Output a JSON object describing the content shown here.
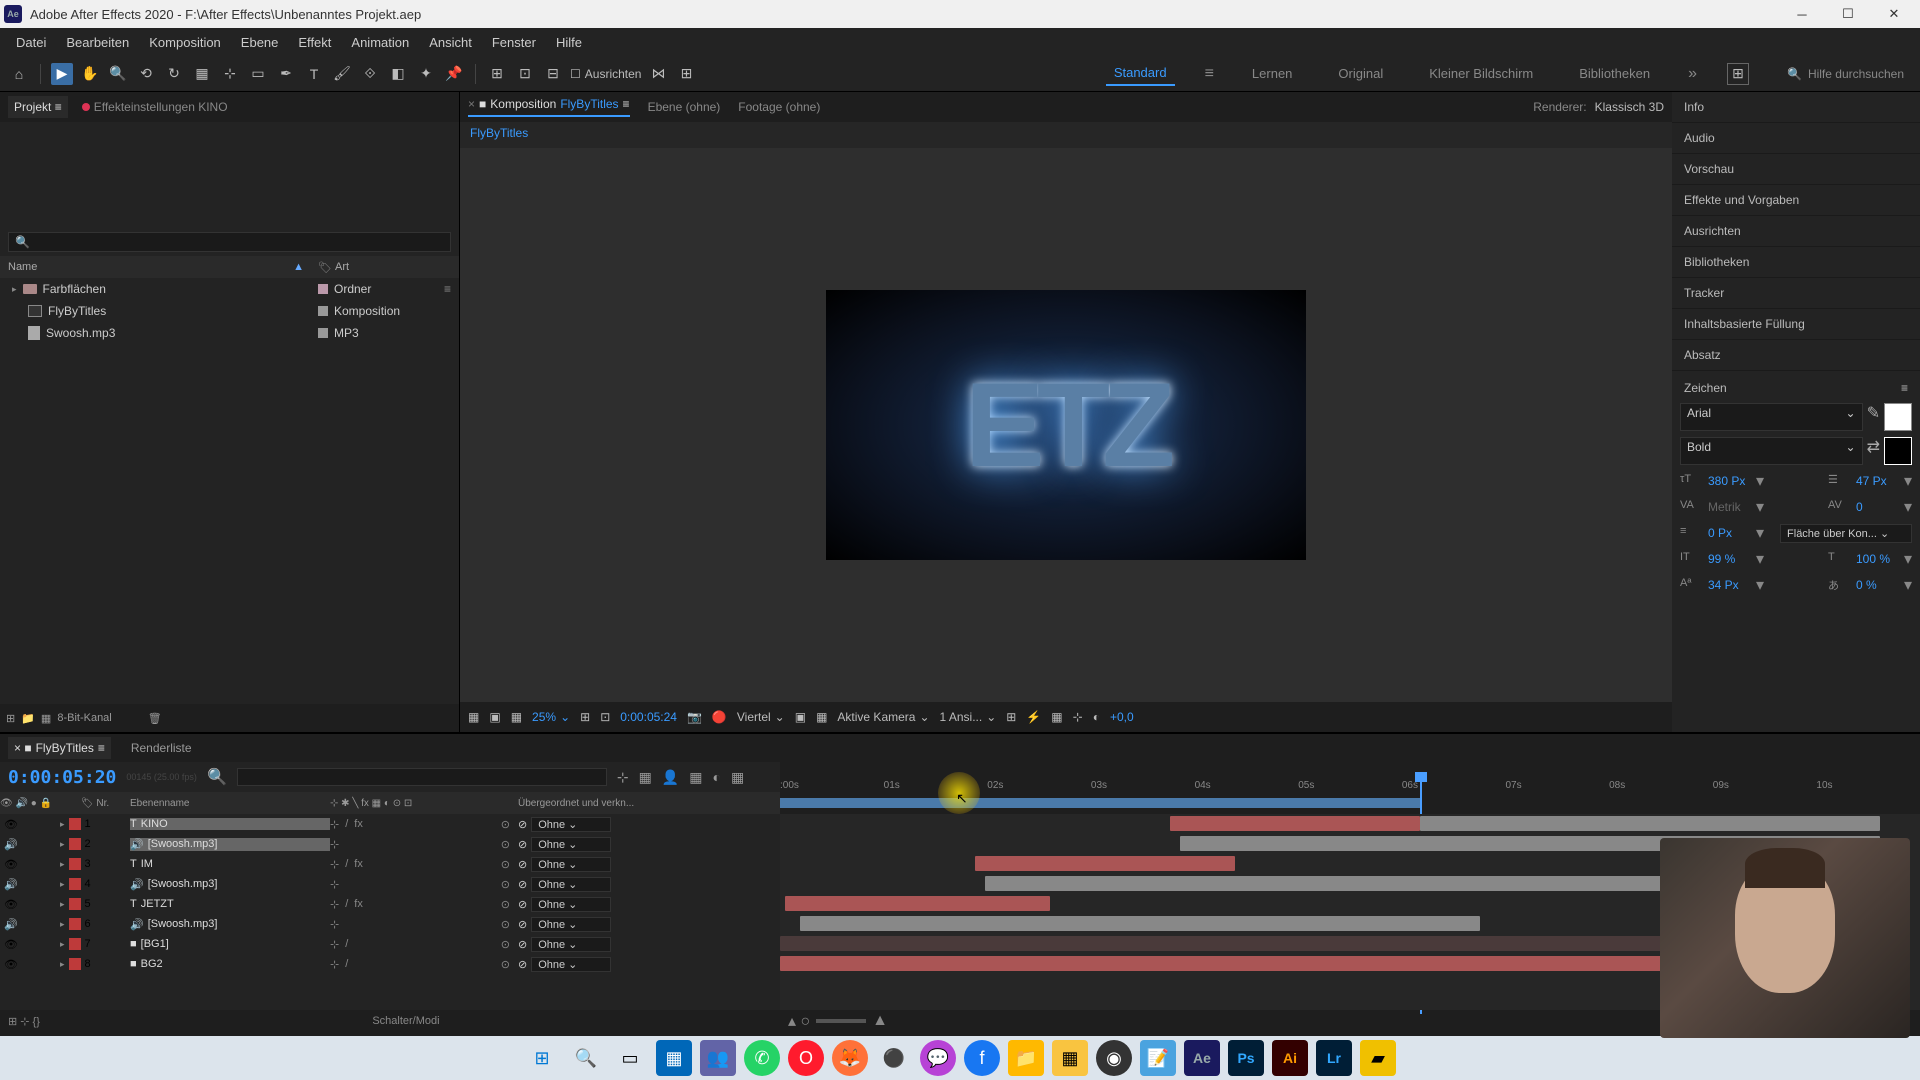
{
  "titlebar": {
    "title": "Adobe After Effects 2020 - F:\\After Effects\\Unbenanntes Projekt.aep"
  },
  "menu": {
    "items": [
      "Datei",
      "Bearbeiten",
      "Komposition",
      "Ebene",
      "Effekt",
      "Animation",
      "Ansicht",
      "Fenster",
      "Hilfe"
    ]
  },
  "toolbar": {
    "ausrichten": "Ausrichten",
    "workspaces": [
      "Standard",
      "Lernen",
      "Original",
      "Kleiner Bildschirm",
      "Bibliotheken"
    ],
    "search_placeholder": "Hilfe durchsuchen"
  },
  "project_panel": {
    "tab": "Projekt",
    "effects_tab": "Effekteinstellungen KINO",
    "header_name": "Name",
    "header_type": "Art",
    "items": [
      {
        "name": "Farbflächen",
        "type": "Ordner",
        "kind": "folder"
      },
      {
        "name": "FlyByTitles",
        "type": "Komposition",
        "kind": "comp"
      },
      {
        "name": "Swoosh.mp3",
        "type": "MP3",
        "kind": "audio"
      }
    ],
    "footer_bit": "8-Bit-Kanal"
  },
  "comp_panel": {
    "tab_prefix": "Komposition",
    "comp_name": "FlyByTitles",
    "tab_layer": "Ebene (ohne)",
    "tab_footage": "Footage (ohne)",
    "renderer_label": "Renderer:",
    "renderer_value": "Klassisch 3D",
    "breadcrumb": "FlyByTitles"
  },
  "viewer_footer": {
    "zoom": "25%",
    "timecode": "0:00:05:24",
    "res": "Viertel",
    "camera": "Aktive Kamera",
    "views": "1 Ansi...",
    "exposure": "+0,0"
  },
  "right_panel": {
    "items": [
      "Info",
      "Audio",
      "Vorschau",
      "Effekte und Vorgaben",
      "Ausrichten",
      "Bibliotheken",
      "Tracker",
      "Inhaltsbasierte Füllung",
      "Absatz"
    ],
    "zeichen": {
      "title": "Zeichen",
      "font": "Arial",
      "weight": "Bold",
      "size": "380 Px",
      "leading": "47 Px",
      "kerning": "Metrik",
      "tracking": "0",
      "stroke": "0 Px",
      "stroke_opt": "Fläche über Kon...",
      "scale_v": "99 %",
      "scale_h": "100 %",
      "baseline": "34 Px",
      "tsume": "0 %"
    }
  },
  "timeline": {
    "tab_name": "FlyByTitles",
    "tab_render": "Renderliste",
    "timecode": "0:00:05:20",
    "frames_hint": "00145 (25.00 fps)",
    "col_num": "Nr.",
    "col_name": "Ebenenname",
    "col_parent": "Übergeordnet und verkn...",
    "parent_none": "Ohne",
    "ticks": [
      ":00s",
      "01s",
      "02s",
      "03s",
      "04s",
      "05s",
      "06s",
      "07s",
      "08s",
      "09s",
      "10s"
    ],
    "layers": [
      {
        "num": 1,
        "name": "KINO",
        "color": "#be3a3a",
        "type": "T",
        "selected": true
      },
      {
        "num": 2,
        "name": "[Swoosh.mp3]",
        "color": "#be3a3a",
        "type": "A",
        "selected": true
      },
      {
        "num": 3,
        "name": "IM",
        "color": "#be3a3a",
        "type": "T",
        "selected": false
      },
      {
        "num": 4,
        "name": "[Swoosh.mp3]",
        "color": "#be3a3a",
        "type": "A",
        "selected": false
      },
      {
        "num": 5,
        "name": "JETZT",
        "color": "#be3a3a",
        "type": "T",
        "selected": false
      },
      {
        "num": 6,
        "name": "[Swoosh.mp3]",
        "color": "#be3a3a",
        "type": "A",
        "selected": false
      },
      {
        "num": 7,
        "name": "[BG1]",
        "color": "#be3a3a",
        "type": "S",
        "selected": false
      },
      {
        "num": 8,
        "name": "BG2",
        "color": "#be3a3a",
        "type": "S",
        "selected": false
      }
    ],
    "footer_label": "Schalter/Modi"
  },
  "taskbar": {
    "icons": [
      "win",
      "search",
      "task",
      "store",
      "teams",
      "whatsapp",
      "opera",
      "firefox",
      "app1",
      "messenger",
      "facebook",
      "explorer",
      "app2",
      "obs",
      "notepad",
      "Ae",
      "Ps",
      "Ai",
      "Lr",
      "app3"
    ]
  }
}
